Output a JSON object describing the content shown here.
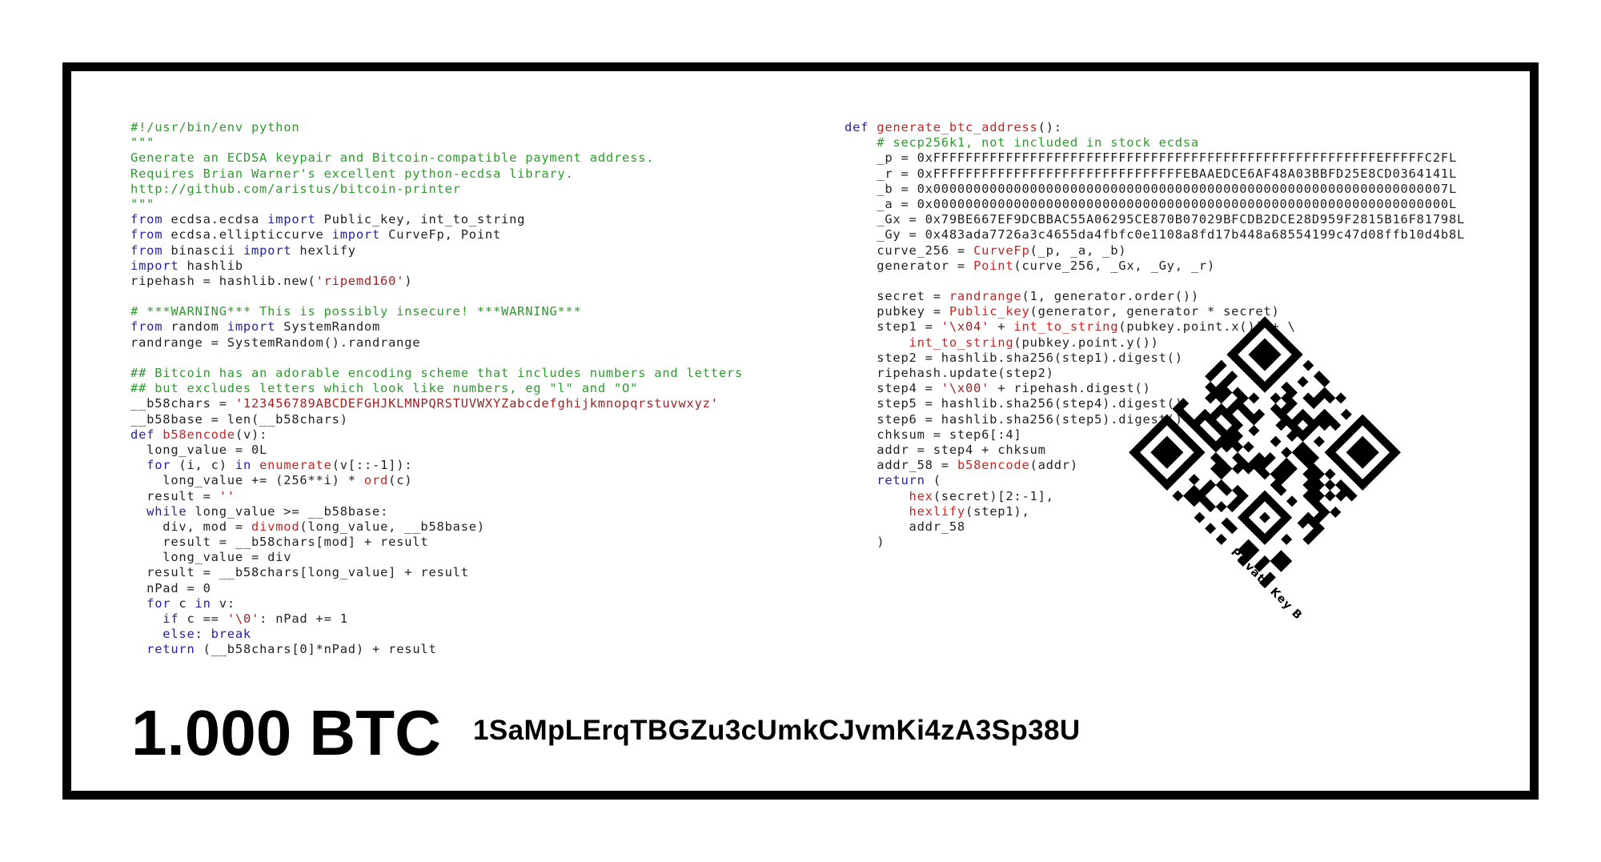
{
  "wallet": {
    "amount": "1.000 BTC",
    "address": "1SaMpLErqTBGZu3cUmkCJvmKi4zA3Sp38U",
    "qr_label": "Private Key B",
    "qr_icon": "qr-code-icon"
  },
  "colors": {
    "comment": "#2e9a2e",
    "keyword": "#2222a0",
    "builtin": "#c42424",
    "string": "#9c2323",
    "text": "#222222",
    "frame": "#000000"
  },
  "code_left": [
    [
      [
        "cm",
        "#!/usr/bin/env python"
      ]
    ],
    [
      [
        "cm",
        "\"\"\""
      ]
    ],
    [
      [
        "cm",
        "Generate an ECDSA keypair and Bitcoin-compatible payment address."
      ]
    ],
    [
      [
        "cm",
        "Requires Brian Warner's excellent python-ecdsa library."
      ]
    ],
    [
      [
        "cm",
        "http://github.com/aristus/bitcoin-printer"
      ]
    ],
    [
      [
        "cm",
        "\"\"\""
      ]
    ],
    [
      [
        "kw",
        "from"
      ],
      [
        "tx",
        " ecdsa.ecdsa "
      ],
      [
        "kw",
        "import"
      ],
      [
        "tx",
        " Public_key, int_to_string"
      ]
    ],
    [
      [
        "kw",
        "from"
      ],
      [
        "tx",
        " ecdsa.ellipticcurve "
      ],
      [
        "kw",
        "import"
      ],
      [
        "tx",
        " CurveFp, Point"
      ]
    ],
    [
      [
        "kw",
        "from"
      ],
      [
        "tx",
        " binascii "
      ],
      [
        "kw",
        "import"
      ],
      [
        "tx",
        " hexlify"
      ]
    ],
    [
      [
        "kw",
        "import"
      ],
      [
        "tx",
        " hashlib"
      ]
    ],
    [
      [
        "tx",
        "ripehash = hashlib.new("
      ],
      [
        "st",
        "'ripemd160'"
      ],
      [
        "tx",
        ")"
      ]
    ],
    [],
    [
      [
        "cm",
        "# ***WARNING*** This is possibly insecure! ***WARNING***"
      ]
    ],
    [
      [
        "kw",
        "from"
      ],
      [
        "tx",
        " random "
      ],
      [
        "kw",
        "import"
      ],
      [
        "tx",
        " SystemRandom"
      ]
    ],
    [
      [
        "tx",
        "randrange = SystemRandom().randrange"
      ]
    ],
    [],
    [
      [
        "cm",
        "## Bitcoin has an adorable encoding scheme that includes numbers and letters"
      ]
    ],
    [
      [
        "cm",
        "## but excludes letters which look like numbers, eg \"l\" and \"O\""
      ]
    ],
    [
      [
        "tx",
        "__b58chars = "
      ],
      [
        "st",
        "'123456789ABCDEFGHJKLMNPQRSTUVWXYZabcdefghijkmnopqrstuvwxyz'"
      ]
    ],
    [
      [
        "tx",
        "__b58base = len(__b58chars)"
      ]
    ],
    [
      [
        "kw",
        "def"
      ],
      [
        "tx",
        " "
      ],
      [
        "fn",
        "b58encode"
      ],
      [
        "tx",
        "(v):"
      ]
    ],
    [
      [
        "tx",
        "  long_value = 0L"
      ]
    ],
    [
      [
        "tx",
        "  "
      ],
      [
        "kw",
        "for"
      ],
      [
        "tx",
        " (i, c) "
      ],
      [
        "kw",
        "in"
      ],
      [
        "tx",
        " "
      ],
      [
        "fn",
        "enumerate"
      ],
      [
        "tx",
        "(v[::-1]):"
      ]
    ],
    [
      [
        "tx",
        "    long_value += (256**i) * "
      ],
      [
        "fn",
        "ord"
      ],
      [
        "tx",
        "(c)"
      ]
    ],
    [
      [
        "tx",
        "  result = "
      ],
      [
        "st",
        "''"
      ]
    ],
    [
      [
        "tx",
        "  "
      ],
      [
        "kw",
        "while"
      ],
      [
        "tx",
        " long_value >= __b58base:"
      ]
    ],
    [
      [
        "tx",
        "    div, mod = "
      ],
      [
        "fn",
        "divmod"
      ],
      [
        "tx",
        "(long_value, __b58base)"
      ]
    ],
    [
      [
        "tx",
        "    result = __b58chars[mod] + result"
      ]
    ],
    [
      [
        "tx",
        "    long_value = div"
      ]
    ],
    [
      [
        "tx",
        "  result = __b58chars[long_value] + result"
      ]
    ],
    [
      [
        "tx",
        "  nPad = 0"
      ]
    ],
    [
      [
        "tx",
        "  "
      ],
      [
        "kw",
        "for"
      ],
      [
        "tx",
        " c "
      ],
      [
        "kw",
        "in"
      ],
      [
        "tx",
        " v:"
      ]
    ],
    [
      [
        "tx",
        "    "
      ],
      [
        "kw",
        "if"
      ],
      [
        "tx",
        " c == "
      ],
      [
        "st",
        "'\\0'"
      ],
      [
        "tx",
        ": nPad += 1"
      ]
    ],
    [
      [
        "tx",
        "    "
      ],
      [
        "kw",
        "else"
      ],
      [
        "tx",
        ": "
      ],
      [
        "kw",
        "break"
      ]
    ],
    [
      [
        "tx",
        "  "
      ],
      [
        "kw",
        "return"
      ],
      [
        "tx",
        " (__b58chars[0]*nPad) + result"
      ]
    ]
  ],
  "code_right": [
    [
      [
        "kw",
        "def"
      ],
      [
        "tx",
        " "
      ],
      [
        "fn",
        "generate_btc_address"
      ],
      [
        "tx",
        "():"
      ]
    ],
    [
      [
        "cm",
        "    # secp256k1, not included in stock ecdsa"
      ]
    ],
    [
      [
        "tx",
        "    _p = 0xFFFFFFFFFFFFFFFFFFFFFFFFFFFFFFFFFFFFFFFFFFFFFFFFFFFFFFFEFFFFFC2FL"
      ]
    ],
    [
      [
        "tx",
        "    _r = 0xFFFFFFFFFFFFFFFFFFFFFFFFFFFFFFFEBAAEDCE6AF48A03BBFD25E8CD0364141L"
      ]
    ],
    [
      [
        "tx",
        "    _b = 0x0000000000000000000000000000000000000000000000000000000000000007L"
      ]
    ],
    [
      [
        "tx",
        "    _a = 0x0000000000000000000000000000000000000000000000000000000000000000L"
      ]
    ],
    [
      [
        "tx",
        "    _Gx = 0x79BE667EF9DCBBAC55A06295CE870B07029BFCDB2DCE28D959F2815B16F81798L"
      ]
    ],
    [
      [
        "tx",
        "    _Gy = 0x483ada7726a3c4655da4fbfc0e1108a8fd17b448a68554199c47d08ffb10d4b8L"
      ]
    ],
    [
      [
        "tx",
        "    curve_256 = "
      ],
      [
        "fn",
        "CurveFp"
      ],
      [
        "tx",
        "(_p, _a, _b)"
      ]
    ],
    [
      [
        "tx",
        "    generator = "
      ],
      [
        "fn",
        "Point"
      ],
      [
        "tx",
        "(curve_256, _Gx, _Gy, _r)"
      ]
    ],
    [],
    [
      [
        "tx",
        "    secret = "
      ],
      [
        "fn",
        "randrange"
      ],
      [
        "tx",
        "(1, generator.order())"
      ]
    ],
    [
      [
        "tx",
        "    pubkey = "
      ],
      [
        "fn",
        "Public_key"
      ],
      [
        "tx",
        "(generator, generator * secret)"
      ]
    ],
    [
      [
        "tx",
        "    step1 = "
      ],
      [
        "st",
        "'\\x04'"
      ],
      [
        "tx",
        " + "
      ],
      [
        "fn",
        "int_to_string"
      ],
      [
        "tx",
        "(pubkey.point.x()) + \\"
      ]
    ],
    [
      [
        "tx",
        "        "
      ],
      [
        "fn",
        "int_to_string"
      ],
      [
        "tx",
        "(pubkey.point.y())"
      ]
    ],
    [
      [
        "tx",
        "    step2 = hashlib.sha256(step1).digest()"
      ]
    ],
    [
      [
        "tx",
        "    ripehash.update(step2)"
      ]
    ],
    [
      [
        "tx",
        "    step4 = "
      ],
      [
        "st",
        "'\\x00'"
      ],
      [
        "tx",
        " + ripehash.digest()"
      ]
    ],
    [
      [
        "tx",
        "    step5 = hashlib.sha256(step4).digest()"
      ]
    ],
    [
      [
        "tx",
        "    step6 = hashlib.sha256(step5).digest()"
      ]
    ],
    [
      [
        "tx",
        "    chksum = step6[:4]"
      ]
    ],
    [
      [
        "tx",
        "    addr = step4 + chksum"
      ]
    ],
    [
      [
        "tx",
        "    addr_58 = "
      ],
      [
        "fn",
        "b58encode"
      ],
      [
        "tx",
        "(addr)"
      ]
    ],
    [
      [
        "tx",
        "    "
      ],
      [
        "kw",
        "return"
      ],
      [
        "tx",
        " ("
      ]
    ],
    [
      [
        "tx",
        "        "
      ],
      [
        "fn",
        "hex"
      ],
      [
        "tx",
        "(secret)[2:-1],"
      ]
    ],
    [
      [
        "tx",
        "        "
      ],
      [
        "fn",
        "hexlify"
      ],
      [
        "tx",
        "(step1),"
      ]
    ],
    [
      [
        "tx",
        "        addr_58"
      ]
    ],
    [
      [
        "tx",
        "    )"
      ]
    ]
  ]
}
